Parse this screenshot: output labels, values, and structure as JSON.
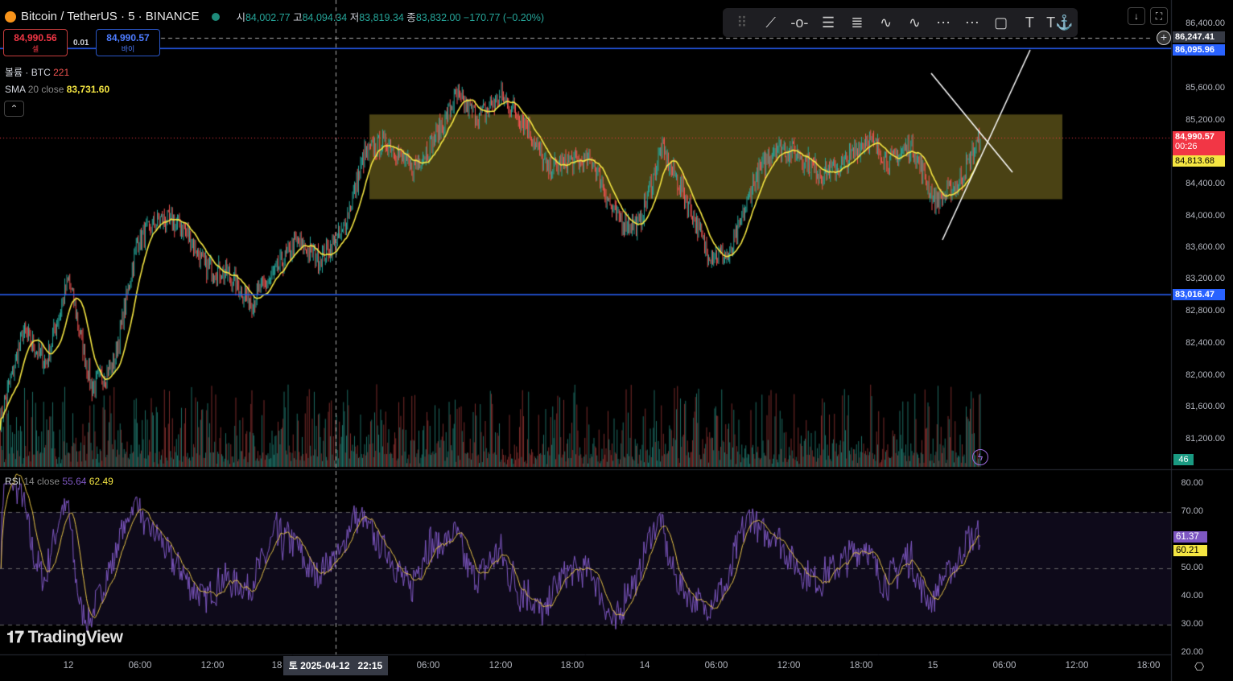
{
  "header": {
    "symbol": "Bitcoin / TetherUS · 5 · BINANCE",
    "o_label": "시",
    "o": "84,002.77",
    "h_label": "고",
    "h": "84,094.34",
    "l_label": "저",
    "l": "83,819.34",
    "c_label": "종",
    "c": "83,832.00",
    "change": "−170.77 (−0.20%)"
  },
  "trade": {
    "sell_price": "84,990.56",
    "sell_label": "셀",
    "spread": "0.01",
    "buy_price": "84,990.57",
    "buy_label": "바이"
  },
  "legend": {
    "volume_label": "볼륨 · BTC",
    "volume_value": "221",
    "sma_label": "SMA",
    "sma_params": "20 close",
    "sma_value": "83,731.60",
    "rsi_label": "RSI",
    "rsi_params": "14 close",
    "rsi_value": "55.64",
    "rsi_ma_value": "62.49"
  },
  "price_axis": [
    "86,400.00",
    "85,600.00",
    "85,200.00",
    "84,400.00",
    "84,000.00",
    "83,600.00",
    "83,200.00",
    "82,800.00",
    "82,400.00",
    "82,000.00",
    "81,600.00",
    "81,200.00"
  ],
  "price_tags": {
    "crosshair": "86,247.41",
    "resistance": "86,095.96",
    "last": "84,990.57",
    "countdown": "00:26",
    "sma": "84,813.68",
    "support": "83,016.47",
    "volume": "46"
  },
  "rsi_axis": [
    "80.00",
    "70.00",
    "50.00",
    "40.00",
    "30.00",
    "20.00"
  ],
  "rsi_tags": {
    "rsi": "61.37",
    "ma": "60.21"
  },
  "time_axis": [
    "12",
    "06:00",
    "12:00",
    "18",
    "06:00",
    "12:00",
    "18:00",
    "14",
    "06:00",
    "12:00",
    "18:00",
    "15",
    "06:00",
    "12:00",
    "18:00"
  ],
  "crosshair_time": "토 2025-04-12   22:15",
  "watermark": "TradingView",
  "colors": {
    "up": "#26a69a",
    "down": "#ef5350",
    "sma": "#f5e642",
    "rsi": "#7e57c2",
    "level": "#2962ff",
    "zone": "#4a4214"
  },
  "chart_data": {
    "type": "candlestick",
    "interval": "5m",
    "keypoints_price": [
      81450,
      82560,
      82160,
      83220,
      81850,
      82160,
      83670,
      83970,
      83870,
      83370,
      83270,
      82920,
      83270,
      83670,
      83470,
      83770,
      84780,
      84930,
      84580,
      84930,
      85490,
      85240,
      85490,
      85180,
      84580,
      84680,
      84680,
      83970,
      83870,
      84830,
      84280,
      83570,
      83470,
      84380,
      84880,
      84780,
      84530,
      84630,
      84990,
      84680,
      84880,
      84180,
      84380,
      84990
    ],
    "levels": [
      86095.96,
      83016.47
    ],
    "zone": [
      84210,
      85270
    ],
    "ylim": [
      80900,
      86500
    ],
    "rsi_ylim": [
      20,
      80
    ]
  }
}
